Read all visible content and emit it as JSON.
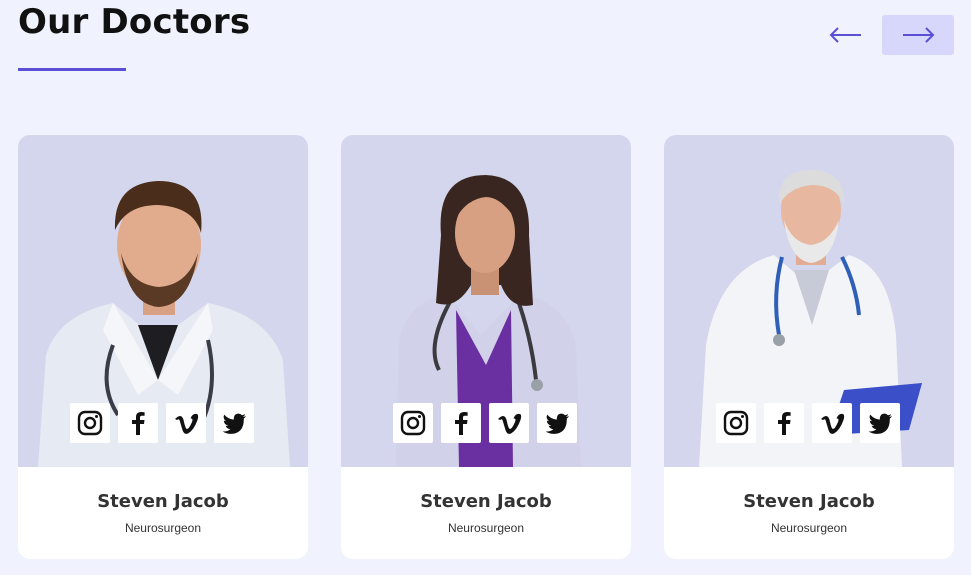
{
  "section": {
    "title": "Our Doctors"
  },
  "colors": {
    "accent": "#5b4fd6",
    "background": "#f0f3fd",
    "photo_bg": "#d3d6ec",
    "next_btn_bg": "#d7d6fb"
  },
  "nav": {
    "prev_icon": "arrow-left-icon",
    "next_icon": "arrow-right-icon"
  },
  "doctors": [
    {
      "name": "Steven Jacob",
      "role": "Neurosurgeon",
      "socials": [
        "instagram-icon",
        "facebook-icon",
        "vimeo-icon",
        "twitter-icon"
      ]
    },
    {
      "name": "Steven Jacob",
      "role": "Neurosurgeon",
      "socials": [
        "instagram-icon",
        "facebook-icon",
        "vimeo-icon",
        "twitter-icon"
      ]
    },
    {
      "name": "Steven Jacob",
      "role": "Neurosurgeon",
      "socials": [
        "instagram-icon",
        "facebook-icon",
        "vimeo-icon",
        "twitter-icon"
      ]
    }
  ]
}
